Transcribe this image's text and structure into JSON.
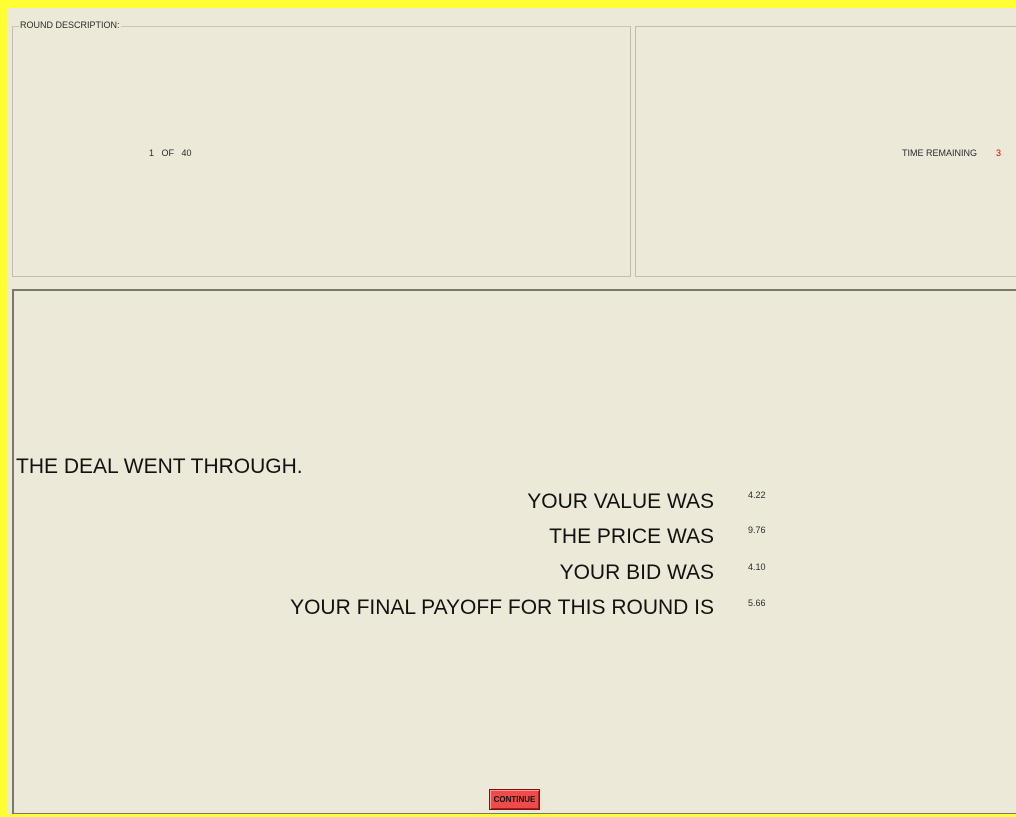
{
  "round_panel": {
    "title": "ROUND DESCRIPTION:",
    "round_number": "1",
    "of_label": "OF",
    "total_rounds": "40"
  },
  "time_panel": {
    "label": "TIME REMAINING",
    "value": "3"
  },
  "result": {
    "status": "THE DEAL WENT THROUGH.",
    "rows": [
      {
        "label": "YOUR VALUE WAS",
        "value": "4.22"
      },
      {
        "label": "THE PRICE WAS",
        "value": "9.76"
      },
      {
        "label": "YOUR BID WAS",
        "value": "4.10"
      },
      {
        "label": "YOUR FINAL PAYOFF FOR THIS ROUND IS",
        "value": "5.66"
      }
    ]
  },
  "continue_button": {
    "label": "CONTINUE"
  },
  "colors": {
    "frame": "#FFFF33",
    "background": "#ECE9D8",
    "time_value": "#E00000",
    "continue_button": "#F04B4B"
  }
}
